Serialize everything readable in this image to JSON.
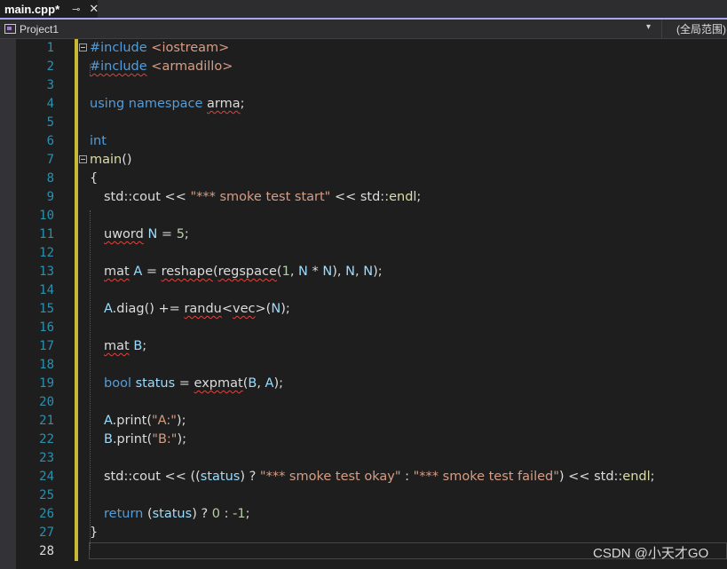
{
  "tab": {
    "title": "main.cpp*"
  },
  "navbar": {
    "project": "Project1",
    "scope": "(全局范围)"
  },
  "code_lines": [
    "#include <iostream>",
    "#include <armadillo>",
    "",
    "using namespace arma;",
    "",
    "int",
    "main()",
    "{",
    "std::cout << \"*** smoke test start\" << std::endl;",
    "",
    "uword N = 5;",
    "",
    "mat A = reshape(regspace(1, N * N), N, N);",
    "",
    "A.diag() += randu<vec>(N);",
    "",
    "mat B;",
    "",
    "bool status = expmat(B, A);",
    "",
    "A.print(\"A:\");",
    "B.print(\"B:\");",
    "",
    "std::cout << ((status) ? \"*** smoke test okay\" : \"*** smoke test failed\") << std::endl;",
    "",
    "return (status) ? 0 : -1;",
    "}",
    ""
  ],
  "line_numbers": [
    "1",
    "2",
    "3",
    "4",
    "5",
    "6",
    "7",
    "8",
    "9",
    "10",
    "11",
    "12",
    "13",
    "14",
    "15",
    "16",
    "17",
    "18",
    "19",
    "20",
    "21",
    "22",
    "23",
    "24",
    "25",
    "26",
    "27",
    "28"
  ],
  "watermark": "CSDN @小天才GO",
  "colors": {
    "keyword": "#569cd6",
    "string": "#d69d85",
    "type": "#4ec9b0",
    "function": "#dcdcaa",
    "variable": "#9cdcfe",
    "line_number": "#2b91af",
    "change_bar": "#c8b833",
    "tab_underline": "#a7a4f0"
  }
}
